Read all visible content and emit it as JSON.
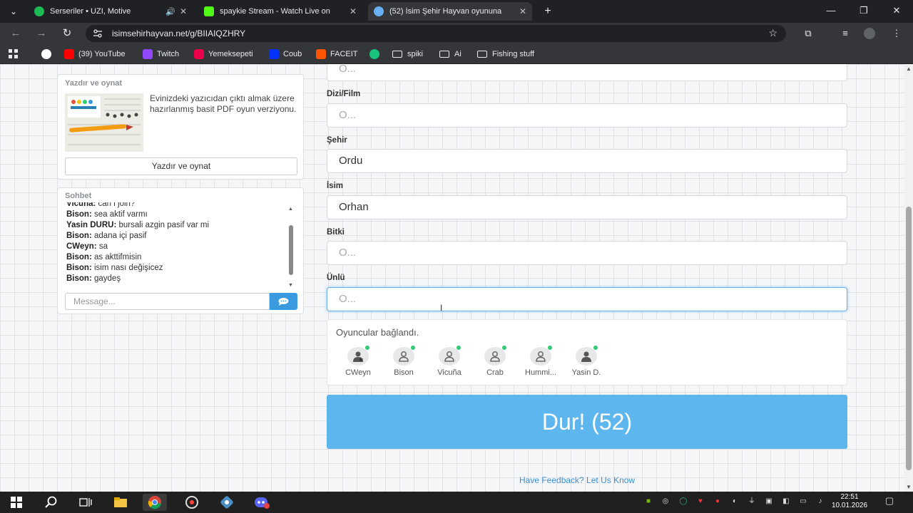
{
  "browser": {
    "tabs": [
      {
        "title": "Serseriler • UZI, Motive",
        "favicon_color": "#1db954",
        "has_speaker": true
      },
      {
        "title": "spaykie Stream - Watch Live on",
        "favicon_color": "#53fc18",
        "has_speaker": false
      },
      {
        "title": "(52) İsim Şehir Hayvan oyununa",
        "favicon_color": "#6ab0f3",
        "has_speaker": false
      }
    ],
    "url": "isimsehirhayvan.net/g/BIIAIQZHRY",
    "bookmarks": [
      {
        "label": "(39) YouTube",
        "icon": "youtube-icon",
        "color": "#ff0000"
      },
      {
        "label": "Twitch",
        "icon": "twitch-icon",
        "color": "#9146ff"
      },
      {
        "label": "Yemeksepeti",
        "icon": "yemeksepeti-icon",
        "color": "#ea004b"
      },
      {
        "label": "Coub",
        "icon": "coub-icon",
        "color": "#0332ff"
      },
      {
        "label": "FACEIT",
        "icon": "faceit-icon",
        "color": "#ff5500"
      },
      {
        "label": "spiki",
        "icon": "folder-icon",
        "color": "#e8eaed"
      },
      {
        "label": "Ai",
        "icon": "folder-icon",
        "color": "#e8eaed"
      },
      {
        "label": "Fishing stuff",
        "icon": "folder-icon",
        "color": "#e8eaed"
      }
    ]
  },
  "print_panel": {
    "title": "Yazdır ve oynat",
    "description": "Evinizdeki yazıcıdan çıktı almak üzere hazırlanmış basit PDF oyun verziyonu.",
    "button": "Yazdır ve oynat"
  },
  "chat": {
    "title": "Sohbet",
    "messages": [
      {
        "user": "Vicuña:",
        "text": "can i join?"
      },
      {
        "user": "Bison:",
        "text": "sea aktif varmı"
      },
      {
        "user": "Yasin DURU:",
        "text": "bursali azgin pasif var mi"
      },
      {
        "user": "Bison:",
        "text": "adana içi pasif"
      },
      {
        "user": "CWeyn:",
        "text": "sa"
      },
      {
        "user": "Bison:",
        "text": "as akttifmisin"
      },
      {
        "user": "Bison:",
        "text": "isim nası değişicez"
      },
      {
        "user": "Bison:",
        "text": "gaydeş"
      }
    ],
    "placeholder": "Message..."
  },
  "form": {
    "top_placeholder": "O...",
    "fields": [
      {
        "label": "Dizi/Film",
        "value": "",
        "placeholder": "O..."
      },
      {
        "label": "Şehir",
        "value": "Ordu",
        "placeholder": ""
      },
      {
        "label": "İsim",
        "value": "Orhan",
        "placeholder": ""
      },
      {
        "label": "Bitki",
        "value": "",
        "placeholder": "O..."
      },
      {
        "label": "Ünlü",
        "value": "",
        "placeholder": "O..."
      }
    ]
  },
  "players": {
    "status": "Oyuncular bağlandı.",
    "list": [
      {
        "name": "CWeyn",
        "online": true
      },
      {
        "name": "Bison",
        "online": true
      },
      {
        "name": "Vicuña",
        "online": true
      },
      {
        "name": "Crab",
        "online": true
      },
      {
        "name": "Hummi...",
        "online": true
      },
      {
        "name": "Yasin D.",
        "online": true
      }
    ]
  },
  "stop_button": "Dur! (52)",
  "feedback_link": "Have Feedback? Let Us Know",
  "taskbar": {
    "time": "22:51",
    "date": "10.01.2026"
  }
}
